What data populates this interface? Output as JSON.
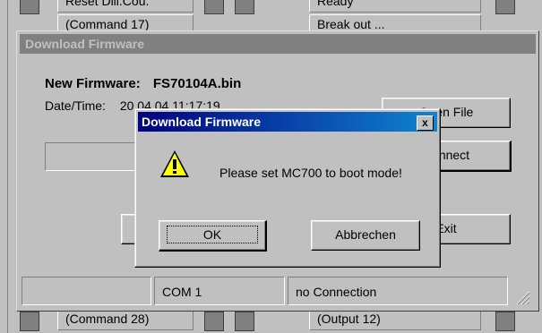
{
  "background": {
    "top_left_text": "Reset Dill.Cou.",
    "top_right_text": "Ready",
    "second_left_text": "(Command 17)",
    "second_right_text": "Break out ...",
    "bottom_left_text": "(Command 28)",
    "bottom_right_text": "(Output 12)"
  },
  "parent_dialog": {
    "title": "Download Firmware",
    "new_firmware_label": "New Firmware:",
    "new_firmware_value": "FS70104A.bin",
    "datetime_label": "Date/Time:",
    "datetime_value": "20.04.04 11:17:19",
    "open_file_button": "Open File",
    "connect_button": "Connect",
    "exit_button": "Exit",
    "status_port": "COM 1",
    "status_connection": "no Connection"
  },
  "modal": {
    "title": "Download Firmware",
    "close_label": "x",
    "message": "Please set MC700 to boot mode!",
    "ok_button": "OK",
    "cancel_button": "Abbrechen",
    "icon": "warning-icon"
  },
  "colors": {
    "title_active_start": "#000080",
    "title_active_end": "#1084d0",
    "title_inactive": "#808080",
    "face": "#c0c0c0"
  }
}
